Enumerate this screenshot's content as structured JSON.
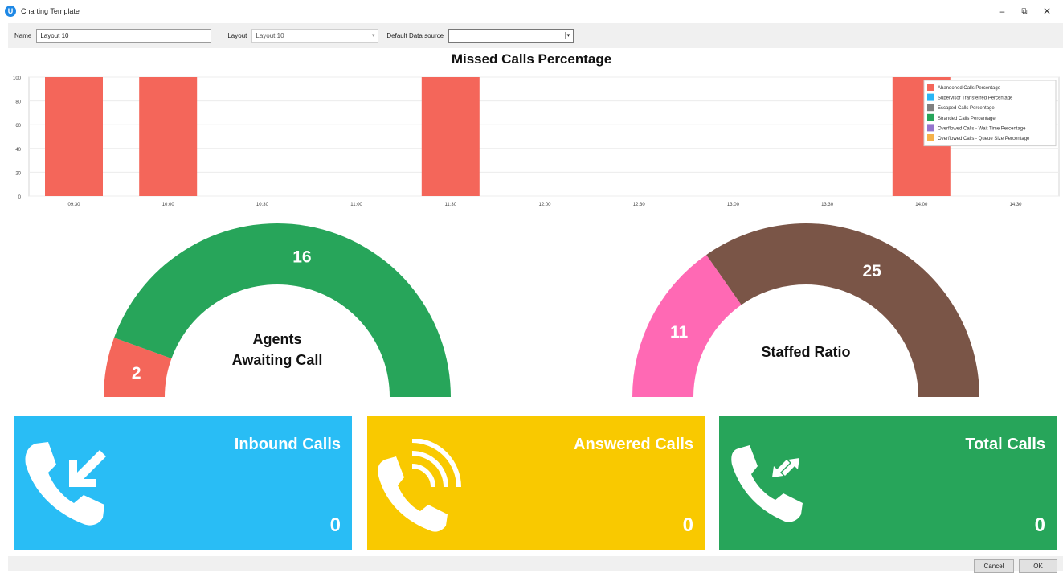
{
  "window": {
    "title": "Charting Template",
    "icon_name": "app-logo-icon",
    "controls": [
      "minimize-icon",
      "restore-icon",
      "close-icon"
    ],
    "minimize_symbol": "–",
    "restore_symbol": "⧉",
    "close_symbol": "✕"
  },
  "toolbar": {
    "name_label": "Name",
    "name_value": "Layout 10",
    "layout_label": "Layout",
    "layout_value": "Layout 10",
    "datasource_label": "Default Data source",
    "datasource_value": ""
  },
  "chart_data": {
    "type": "bar",
    "title": "Missed Calls Percentage",
    "xlabel": "",
    "ylabel": "",
    "ylim": [
      0,
      100
    ],
    "y_ticks": [
      "0",
      "20",
      "40",
      "60",
      "80",
      "100"
    ],
    "categories": [
      "09:30",
      "10:00",
      "10:30",
      "11:00",
      "11:30",
      "12:00",
      "12:30",
      "13:00",
      "13:30",
      "14:00",
      "14:30"
    ],
    "series": [
      {
        "name": "Abandoned Calls Percentage",
        "color": "#f4665a",
        "points": [
          {
            "x": "09:30",
            "y": 100
          },
          {
            "x": "10:00",
            "y": 100
          },
          {
            "x": "11:30",
            "y": 100
          },
          {
            "x": "14:00",
            "y": 100
          }
        ]
      },
      {
        "name": "Supervisor Transferred Percentage",
        "color": "#29b6f6",
        "points": []
      },
      {
        "name": "Escaped Calls Percentage",
        "color": "#808080",
        "points": []
      },
      {
        "name": "Stranded Calls Percentage",
        "color": "#27a55a",
        "points": []
      },
      {
        "name": "Overflowed Calls - Wait Time Percentage",
        "color": "#9575cd",
        "points": []
      },
      {
        "name": "Overflowed Calls - Queue Size Percentage",
        "color": "#f6b24a",
        "points": []
      }
    ],
    "grid": true,
    "legend_position": "top-right"
  },
  "gauges": [
    {
      "label": "Agents Awaiting Call",
      "segments": [
        {
          "value": 2,
          "label": "2",
          "color": "#f4665a"
        },
        {
          "value": 16,
          "label": "16",
          "color": "#27a55a"
        }
      ]
    },
    {
      "label": "Staffed Ratio",
      "segments": [
        {
          "value": 11,
          "label": "11",
          "color": "#ff69b4"
        },
        {
          "value": 25,
          "label": "25",
          "color": "#7a5547"
        }
      ]
    }
  ],
  "tiles": [
    {
      "title": "Inbound Calls",
      "value": "0",
      "color": "#29bdf5",
      "icon": "phone-inbound-icon"
    },
    {
      "title": "Answered Calls",
      "value": "0",
      "color": "#f9c900",
      "icon": "phone-ringing-icon"
    },
    {
      "title": "Total Calls",
      "value": "0",
      "color": "#27a55a",
      "icon": "phone-transfer-icon"
    }
  ],
  "footer": {
    "cancel_label": "Cancel",
    "ok_label": "OK"
  }
}
